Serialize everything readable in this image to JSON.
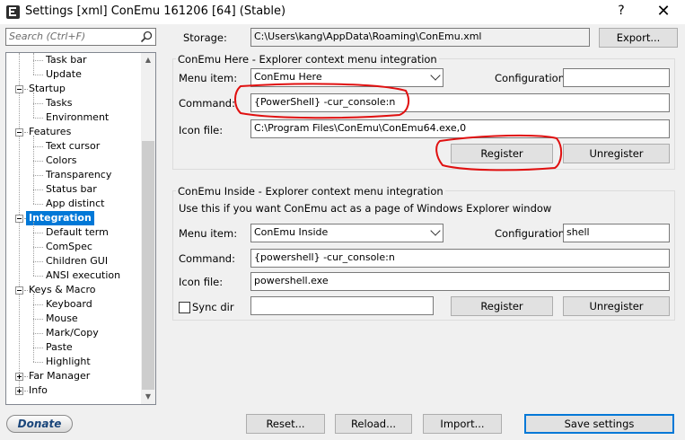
{
  "window": {
    "title": "Settings [xml] ConEmu 161206 [64] (Stable)",
    "help": "?",
    "close": "✕"
  },
  "search": {
    "placeholder": "Search (Ctrl+F)"
  },
  "tree": [
    {
      "label": "Task bar",
      "level": 2
    },
    {
      "label": "Update",
      "level": 2
    },
    {
      "label": "Startup",
      "level": 1,
      "expander": "minus"
    },
    {
      "label": "Tasks",
      "level": 2
    },
    {
      "label": "Environment",
      "level": 2
    },
    {
      "label": "Features",
      "level": 1,
      "expander": "minus"
    },
    {
      "label": "Text cursor",
      "level": 2
    },
    {
      "label": "Colors",
      "level": 2
    },
    {
      "label": "Transparency",
      "level": 2
    },
    {
      "label": "Status bar",
      "level": 2
    },
    {
      "label": "App distinct",
      "level": 2
    },
    {
      "label": "Integration",
      "level": 1,
      "expander": "minus",
      "selected": true
    },
    {
      "label": "Default term",
      "level": 2
    },
    {
      "label": "ComSpec",
      "level": 2
    },
    {
      "label": "Children GUI",
      "level": 2
    },
    {
      "label": "ANSI execution",
      "level": 2
    },
    {
      "label": "Keys & Macro",
      "level": 1,
      "expander": "minus"
    },
    {
      "label": "Keyboard",
      "level": 2
    },
    {
      "label": "Mouse",
      "level": 2
    },
    {
      "label": "Mark/Copy",
      "level": 2
    },
    {
      "label": "Paste",
      "level": 2
    },
    {
      "label": "Highlight",
      "level": 2
    },
    {
      "label": "Far Manager",
      "level": 1,
      "expander": "plus"
    },
    {
      "label": "Info",
      "level": 1,
      "expander": "plus"
    }
  ],
  "storage": {
    "label": "Storage:",
    "value": "C:\\Users\\kang\\AppData\\Roaming\\ConEmu.xml",
    "export": "Export..."
  },
  "here": {
    "legend": "ConEmu Here - Explorer context menu integration",
    "menu_label": "Menu item:",
    "menu_value": "ConEmu Here",
    "config_label": "Configuration:",
    "config_value": "",
    "command_label": "Command:",
    "command_value": "{PowerShell} -cur_console:n",
    "icon_label": "Icon file:",
    "icon_value": "C:\\Program Files\\ConEmu\\ConEmu64.exe,0",
    "register": "Register",
    "unregister": "Unregister"
  },
  "inside": {
    "legend": "ConEmu Inside - Explorer context menu integration",
    "desc": "Use this if you want ConEmu act as a page of Windows Explorer window",
    "menu_label": "Menu item:",
    "menu_value": "ConEmu Inside",
    "config_label": "Configuration:",
    "config_value": "shell",
    "command_label": "Command:",
    "command_value": "{powershell} -cur_console:n",
    "icon_label": "Icon file:",
    "icon_value": "powershell.exe",
    "sync_label": "Sync dir",
    "sync_checked": false,
    "sync_value": "",
    "register": "Register",
    "unregister": "Unregister"
  },
  "footer": {
    "donate": "Donate",
    "reset": "Reset...",
    "reload": "Reload...",
    "import": "Import...",
    "save": "Save settings"
  },
  "colors": {
    "selection": "#0078d7",
    "annotation": "#e01010"
  }
}
